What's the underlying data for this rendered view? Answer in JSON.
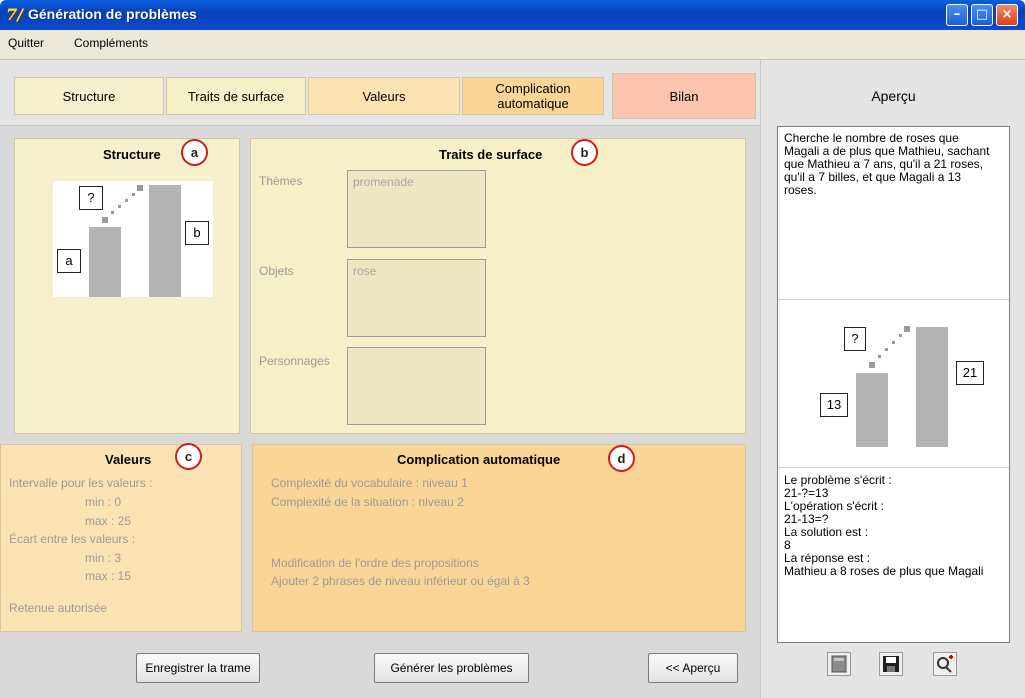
{
  "window": {
    "title": "Génération de problèmes"
  },
  "menu": {
    "quit": "Quitter",
    "complements": "Compléments"
  },
  "tabs": [
    {
      "label": "Structure",
      "color": "#f7f0cf"
    },
    {
      "label": "Traits de surface",
      "color": "#f7efc5"
    },
    {
      "label": "Valeurs",
      "color": "#fbe3b4"
    },
    {
      "label": "Complication automatique",
      "color": "#fbd596"
    },
    {
      "label": "Bilan",
      "color": "#fbc6ad"
    }
  ],
  "panels": {
    "structure": {
      "title": "Structure",
      "marker": "a",
      "diagram": {
        "q": "?",
        "a": "a",
        "b": "b"
      }
    },
    "surface": {
      "title": "Traits de surface",
      "marker": "b",
      "themes_label": "Thèmes",
      "themes_value": "promenade",
      "objects_label": "Objets",
      "objects_value": "rose",
      "characters_label": "Personnages",
      "characters_value": ""
    },
    "values": {
      "title": "Valeurs",
      "marker": "c",
      "range_label": "Intervalle pour les valeurs :",
      "range_min": "min : 0",
      "range_max": "max : 25",
      "gap_label": "Écart entre les valeurs :",
      "gap_min": "min : 3",
      "gap_max": "max : 15",
      "carry": "Retenue autorisée"
    },
    "complication": {
      "title": "Complication automatique",
      "marker": "d",
      "vocab": "Complexité du vocabulaire : niveau 1",
      "situation": "Complexité de la situation : niveau 2",
      "order": "Modification de l'ordre des propositions",
      "phrases": "Ajouter 2 phrases de niveau inférieur ou égal à 3"
    }
  },
  "buttons": {
    "save": "Enregistrer la trame",
    "generate": "Générer les problèmes",
    "preview": "<< Aperçu"
  },
  "side": {
    "title": "Aperçu",
    "problem_lines": [
      "Cherche le nombre de roses que",
      "Magali a de plus que Mathieu, sachant",
      "que Mathieu a 7 ans, qu'il a 21 roses,",
      "qu'il a 7 billes, et que Magali a 13",
      "roses."
    ],
    "diagram": {
      "q": "?",
      "small": "13",
      "big": "21"
    },
    "solution_lines": [
      "Le problème s'écrit :",
      "21-?=13",
      "L'opération s'écrit :",
      "21-13=?",
      "La solution est :",
      "8",
      "La réponse est :",
      "Mathieu a 8 roses de plus que Magali"
    ],
    "icons": [
      "book-icon",
      "save-icon",
      "zoom-icon"
    ]
  }
}
